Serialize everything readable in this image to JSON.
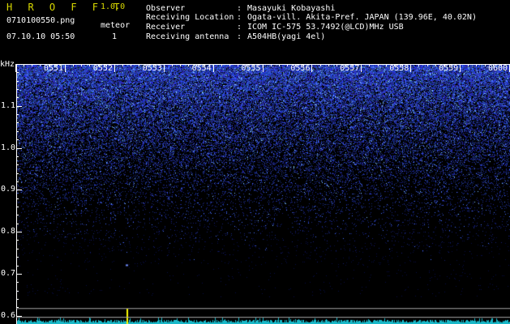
{
  "header": {
    "app_title": "H R O F F T",
    "version": "1.0.0",
    "filename": "0710100550.png",
    "datetime": "07.10.10 05:50",
    "meteor_label": "meteor",
    "meteor_count": "1"
  },
  "info": [
    {
      "label": "Observer",
      "value": "Masayuki Kobayashi"
    },
    {
      "label": "Receiving Location",
      "value": "Ogata-vill. Akita-Pref. JAPAN (139.96E, 40.02N)"
    },
    {
      "label": "Receiver",
      "value": "ICOM IC-575 53.7492(@LCD)MHz USB"
    },
    {
      "label": "Receiving antenna",
      "value": "A504HB(yagi 4el)"
    }
  ],
  "info_separator": ":",
  "chart_data": {
    "type": "heatmap",
    "ylabel": "kHz",
    "y_ticks": [
      "1.1",
      "1.0",
      "0.9",
      "0.8",
      "0.7",
      "0.6"
    ],
    "y_tick_values": [
      1.1,
      1.0,
      0.9,
      0.8,
      0.7,
      0.6
    ],
    "ylim": [
      0.58,
      1.2
    ],
    "x_ticks": [
      "0551",
      "0552",
      "0553",
      "0554",
      "0555",
      "0556",
      "0557",
      "0558",
      "0559",
      "0600"
    ],
    "x_range_minutes": [
      0,
      10
    ],
    "meteor_event": {
      "time_minutes": 2.25,
      "freq_khz": 0.65
    },
    "colors": {
      "background": "#000000",
      "noise_strong": "#3a52ff",
      "noise_peak": "#80c8ff",
      "lower_trace": "#19b8c8",
      "event_marker": "#ffff00",
      "reference_line": "#a0a0a0"
    }
  }
}
